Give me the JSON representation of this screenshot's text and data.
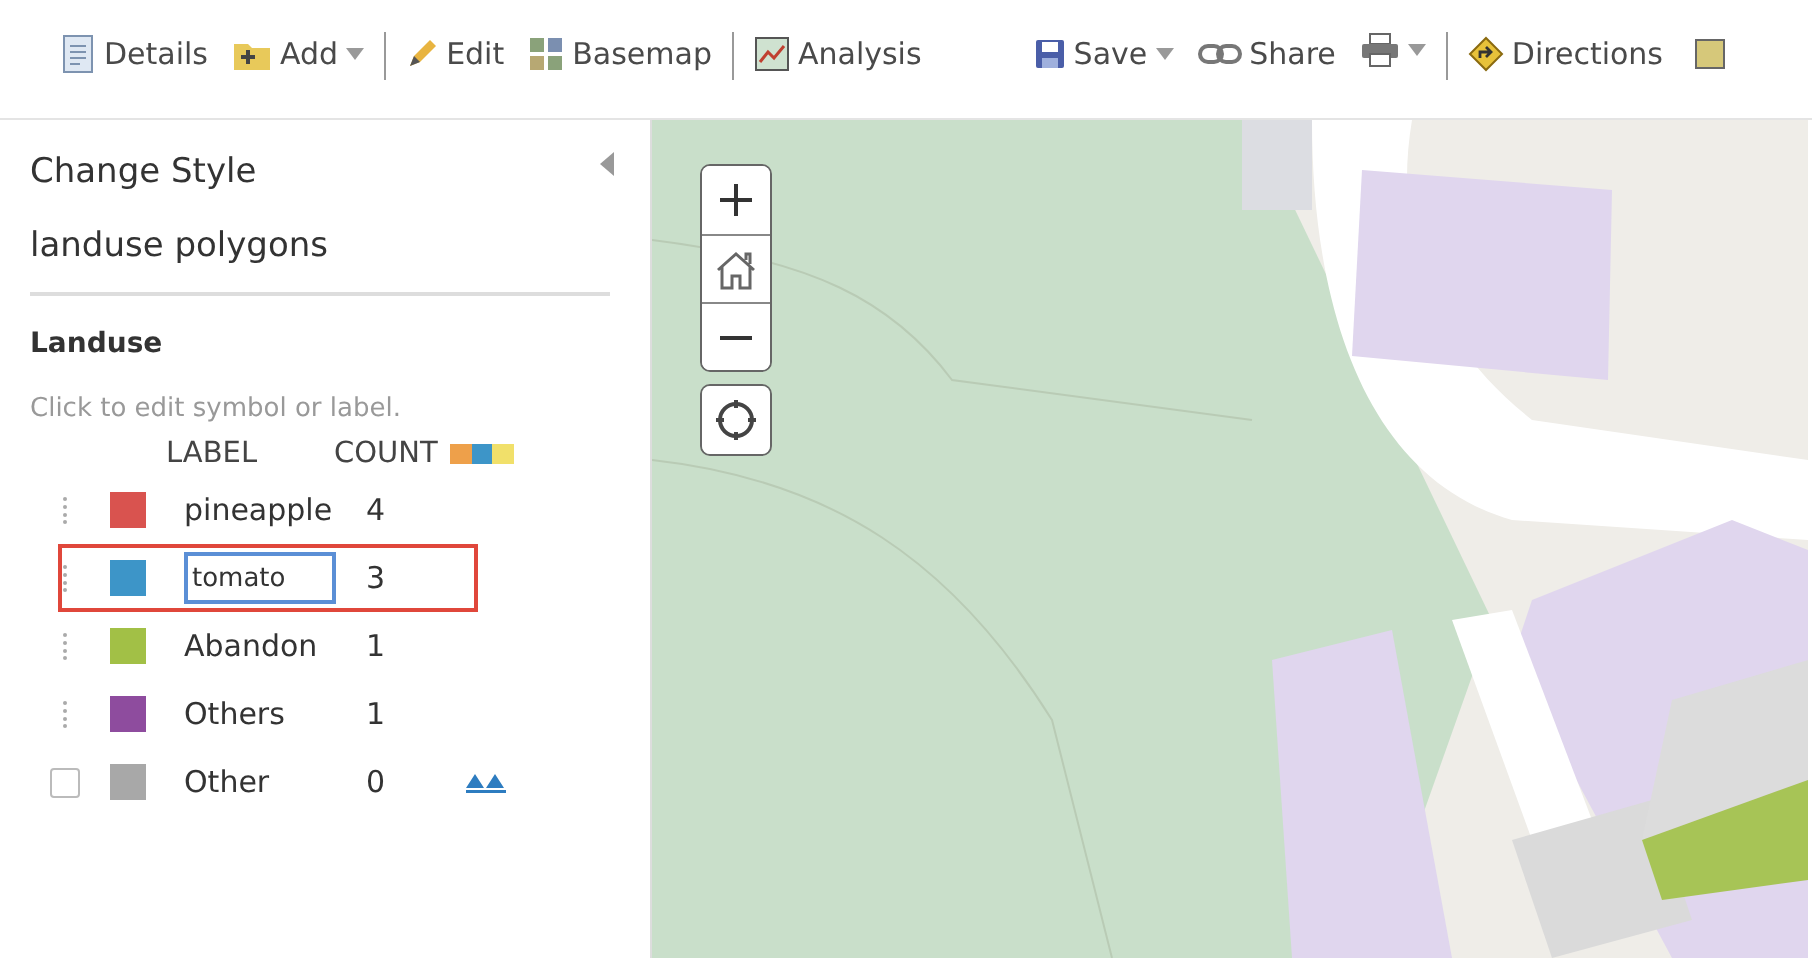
{
  "toolbar": [
    {
      "kind": "button",
      "label": "Details",
      "caret": false
    },
    {
      "kind": "button",
      "label": "Add",
      "caret": true
    },
    {
      "kind": "separator"
    },
    {
      "kind": "button",
      "label": "Edit",
      "caret": false
    },
    {
      "kind": "button",
      "label": "Basemap",
      "caret": false
    },
    {
      "kind": "separator"
    },
    {
      "kind": "button",
      "label": "Analysis",
      "caret": false
    },
    {
      "kind": "spacer"
    },
    {
      "kind": "button",
      "label": "Save",
      "caret": true
    },
    {
      "kind": "button",
      "label": "Share",
      "caret": false
    },
    {
      "kind": "button",
      "caret": true
    },
    {
      "kind": "separator"
    },
    {
      "kind": "button",
      "label": "Directions",
      "caret": false
    }
  ],
  "panel": {
    "title": "Change Style",
    "layer": "landuse polygons",
    "field": "Landuse",
    "hint": "Click to edit symbol or label.",
    "columns": [
      "LABEL",
      "COUNT"
    ],
    "rows": [
      {
        "kind": "drag",
        "color": "#d9534f",
        "label": "pineapple",
        "count": "4",
        "editing": false,
        "highlighted": false
      },
      {
        "kind": "drag",
        "color": "#3d95c8",
        "label": "tomato",
        "count": "3",
        "editing": true,
        "highlighted": true
      },
      {
        "kind": "drag",
        "color": "#a2c046",
        "label": "Abandon",
        "count": "1",
        "editing": false,
        "highlighted": false
      },
      {
        "kind": "drag",
        "color": "#8e4c9e",
        "label": "Others",
        "count": "1",
        "editing": false,
        "highlighted": false
      },
      {
        "kind": "checkbox",
        "color": "#a8a8a8",
        "label": "Other",
        "count": "0",
        "editing": false,
        "highlighted": false,
        "checked": false,
        "promote": true
      }
    ]
  }
}
